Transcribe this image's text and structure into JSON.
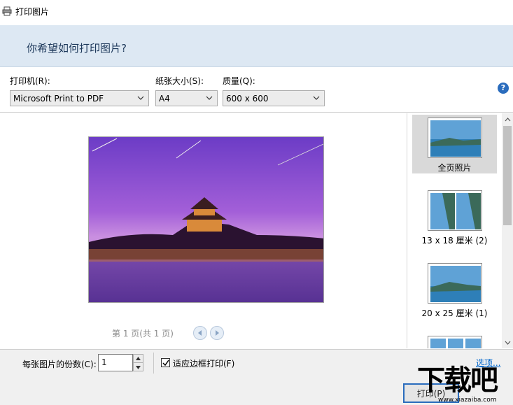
{
  "window": {
    "title": "打印图片"
  },
  "banner": {
    "question": "你希望如何打印图片?"
  },
  "options": {
    "printer_label": "打印机(R):",
    "printer_value": "Microsoft Print to PDF",
    "paper_label": "纸张大小(S):",
    "paper_value": "A4",
    "quality_label": "质量(Q):",
    "quality_value": "600 x 600",
    "help_glyph": "?"
  },
  "preview": {
    "pager": "第 1 页(共 1 页)"
  },
  "layouts": [
    {
      "label": "全页照片"
    },
    {
      "label": "13 x 18 厘米 (2)"
    },
    {
      "label": "20 x 25 厘米 (1)"
    }
  ],
  "bottom": {
    "copies_label": "每张图片的份数(C):",
    "copies_value": "1",
    "fit_label": "适应边框打印(F)",
    "options_link": "选项...",
    "print_button": "打印(P)"
  },
  "watermark": {
    "text": "下载吧",
    "sub": "www.xiazaiba.com"
  },
  "colors": {
    "banner": "#dde8f3",
    "accent": "#2a6cbd",
    "selected": "#d9d9d9"
  }
}
